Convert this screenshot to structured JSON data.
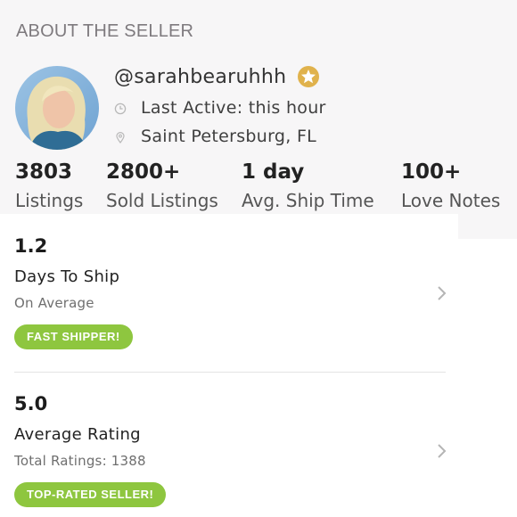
{
  "section_title": "ABOUT THE SELLER",
  "seller": {
    "username": "@sarahbearuhhh",
    "badge_icon": "gold-star-badge",
    "last_active": "Last Active: this hour",
    "location": "Saint Petersburg, FL"
  },
  "stats": [
    {
      "value": "3803",
      "label": "Listings"
    },
    {
      "value": "2800+",
      "label": "Sold Listings"
    },
    {
      "value": "1 day",
      "label": "Avg. Ship Time"
    },
    {
      "value": "100+",
      "label": "Love Notes"
    }
  ],
  "metrics": [
    {
      "value": "1.2",
      "title": "Days To Ship",
      "subtitle": "On Average",
      "badge": "FAST SHIPPER!"
    },
    {
      "value": "5.0",
      "title": "Average Rating",
      "subtitle": "Total Ratings: 1388",
      "badge": "TOP-RATED SELLER!"
    }
  ],
  "colors": {
    "badge_green": "#8ec63f",
    "gold_badge": "#e0b24c",
    "header_bg": "#f7f6f7"
  }
}
